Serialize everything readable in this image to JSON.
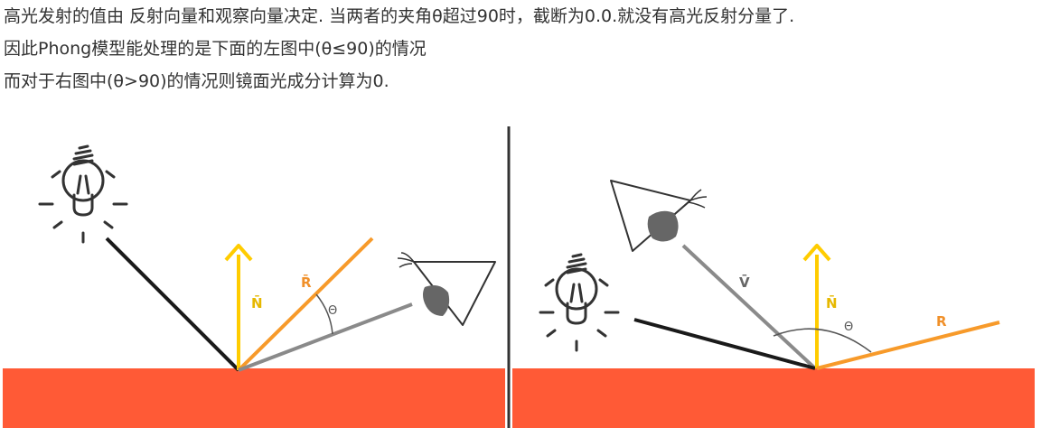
{
  "text": {
    "line1": "高光发射的值由 反射向量和观察向量决定. 当两者的夹角θ超过90时，截断为0.0.就没有高光反射分量了.",
    "line2": "因此Phong模型能处理的是下面的左图中(θ≤90)的情况",
    "line3": "而对于右图中(θ>90)的情况则镜面光成分计算为0."
  },
  "left_diagram": {
    "normal_label": "N̄",
    "reflect_label": "R̄",
    "angle_label": "Θ"
  },
  "right_diagram": {
    "view_label": "V̄",
    "normal_label": "N̄",
    "reflect_label": "R",
    "angle_label": "Θ"
  },
  "colors": {
    "surface": "#ff5a36",
    "normal": "#ffcc00",
    "reflect": "#f79a2a",
    "view": "#8a8a8a",
    "light_ray": "#1a1a1a",
    "divider": "#333333"
  }
}
